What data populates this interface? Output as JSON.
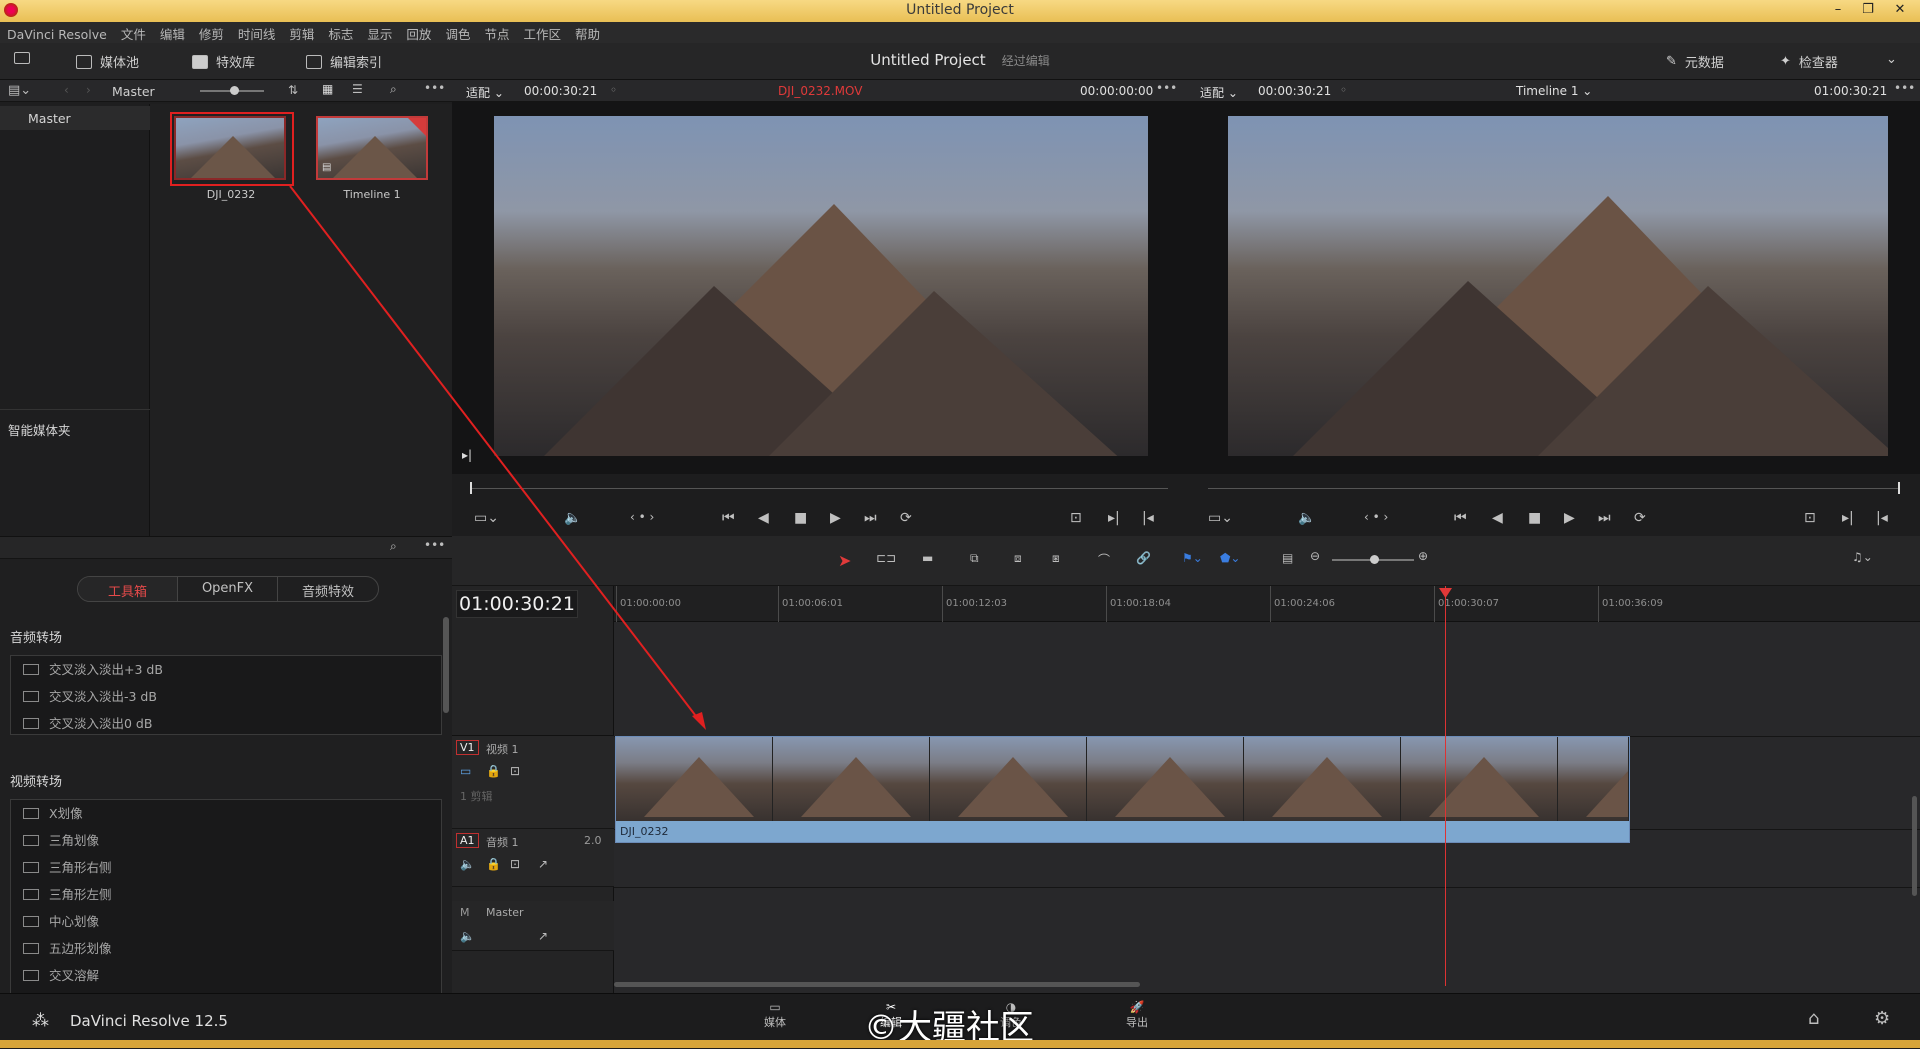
{
  "window": {
    "title": "Untitled Project"
  },
  "menu": [
    "DaVinci Resolve",
    "文件",
    "编辑",
    "修剪",
    "时间线",
    "剪辑",
    "标志",
    "显示",
    "回放",
    "调色",
    "节点",
    "工作区",
    "帮助"
  ],
  "toolbar": {
    "media_pool": "媒体池",
    "effects_library": "特效库",
    "edit_index": "编辑索引",
    "project_title": "Untitled Project",
    "project_sub": "经过编辑",
    "metadata": "元数据",
    "inspector": "检查器"
  },
  "media_pool": {
    "bin_label": "Master",
    "bin_master": "Master",
    "smart_bins": "智能媒体夹",
    "clips": [
      {
        "name": "DJI_0232"
      },
      {
        "name": "Timeline 1"
      }
    ]
  },
  "source_viewer": {
    "fit": "适配",
    "tc_left": "00:00:30:21",
    "clip_name": "DJI_0232.MOV",
    "tc_right": "00:00:00:00"
  },
  "timeline_viewer": {
    "fit": "适配",
    "tc_left": "00:00:30:21",
    "timeline_name": "Timeline 1",
    "tc_right": "01:00:30:21"
  },
  "effects": {
    "tabs": [
      "工具箱",
      "OpenFX",
      "音频特效"
    ],
    "audio_section": "音频转场",
    "audio_items": [
      "交叉淡入淡出+3 dB",
      "交叉淡入淡出-3 dB",
      "交叉淡入淡出0 dB"
    ],
    "video_section": "视频转场",
    "video_items": [
      "X划像",
      "三角划像",
      "三角形右侧",
      "三角形左侧",
      "中心划像",
      "五边形划像",
      "交叉溶解"
    ]
  },
  "timeline": {
    "timecode": "01:00:30:21",
    "ruler_labels": [
      "01:00:00:00",
      "01:00:06:01",
      "01:00:12:03",
      "01:00:18:04",
      "01:00:24:06",
      "01:00:30:07",
      "01:00:36:09"
    ],
    "v1_label": "V1",
    "v1_name": "视频 1",
    "v1_count": "1 剪辑",
    "a1_label": "A1",
    "a1_name": "音频 1",
    "a1_channels": "2.0",
    "master_label": "M",
    "master_name": "Master",
    "clip_name": "DJI_0232"
  },
  "footer": {
    "app_name": "DaVinci Resolve 12.5",
    "pages": [
      "媒体",
      "编辑",
      "调色",
      "导出"
    ],
    "watermark": "©大疆社区"
  },
  "colors": {
    "accent_red": "#e02020",
    "clip_blue": "#7da7cf",
    "title_gold": "#e9bf55"
  }
}
